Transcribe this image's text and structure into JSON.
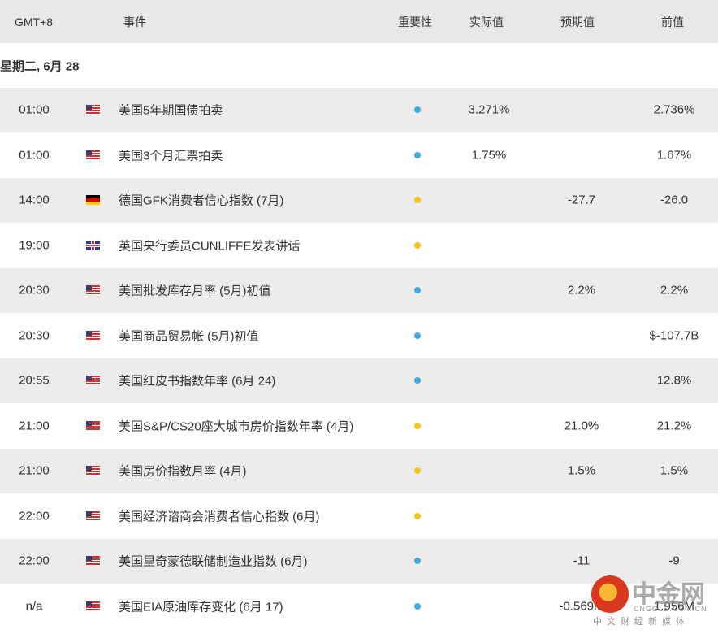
{
  "header": {
    "time": "GMT+8",
    "event": "事件",
    "importance": "重要性",
    "actual": "实际值",
    "forecast": "预期值",
    "previous": "前值"
  },
  "date_label": "星期二, 6月 28",
  "colors": {
    "high": "#f5c518",
    "low": "#3fa9e0",
    "row_alt": "#ececec"
  },
  "rows": [
    {
      "time": "01:00",
      "flag": "us",
      "event": "美国5年期国债拍卖",
      "importance": "low",
      "actual": "3.271%",
      "forecast": "",
      "previous": "2.736%"
    },
    {
      "time": "01:00",
      "flag": "us",
      "event": "美国3个月汇票拍卖",
      "importance": "low",
      "actual": "1.75%",
      "forecast": "",
      "previous": "1.67%"
    },
    {
      "time": "14:00",
      "flag": "de",
      "event": "德国GFK消费者信心指数 (7月)",
      "importance": "high",
      "actual": "",
      "forecast": "-27.7",
      "previous": "-26.0"
    },
    {
      "time": "19:00",
      "flag": "gb",
      "event": "英国央行委员CUNLIFFE发表讲话",
      "importance": "high",
      "actual": "",
      "forecast": "",
      "previous": ""
    },
    {
      "time": "20:30",
      "flag": "us",
      "event": "美国批发库存月率 (5月)初值",
      "importance": "low",
      "actual": "",
      "forecast": "2.2%",
      "previous": "2.2%"
    },
    {
      "time": "20:30",
      "flag": "us",
      "event": "美国商品贸易帐 (5月)初值",
      "importance": "low",
      "actual": "",
      "forecast": "",
      "previous": "$-107.7B"
    },
    {
      "time": "20:55",
      "flag": "us",
      "event": "美国红皮书指数年率 (6月 24)",
      "importance": "low",
      "actual": "",
      "forecast": "",
      "previous": "12.8%"
    },
    {
      "time": "21:00",
      "flag": "us",
      "event": "美国S&P/CS20座大城市房价指数年率 (4月)",
      "importance": "high",
      "actual": "",
      "forecast": "21.0%",
      "previous": "21.2%"
    },
    {
      "time": "21:00",
      "flag": "us",
      "event": "美国房价指数月率 (4月)",
      "importance": "high",
      "actual": "",
      "forecast": "1.5%",
      "previous": "1.5%"
    },
    {
      "time": "22:00",
      "flag": "us",
      "event": "美国经济谘商会消费者信心指数 (6月)",
      "importance": "high",
      "actual": "",
      "forecast": "",
      "previous": ""
    },
    {
      "time": "22:00",
      "flag": "us",
      "event": "美国里奇蒙德联储制造业指数 (6月)",
      "importance": "low",
      "actual": "",
      "forecast": "-11",
      "previous": "-9"
    },
    {
      "time": "n/a",
      "flag": "us",
      "event": "美国EIA原油库存变化 (6月 17)",
      "importance": "low",
      "actual": "",
      "forecast": "-0.569M",
      "previous": "1.956M"
    }
  ],
  "watermark": {
    "name": "中金网",
    "domain": "CNGOLD.COM.CN",
    "tagline": "中文财经新媒体"
  }
}
